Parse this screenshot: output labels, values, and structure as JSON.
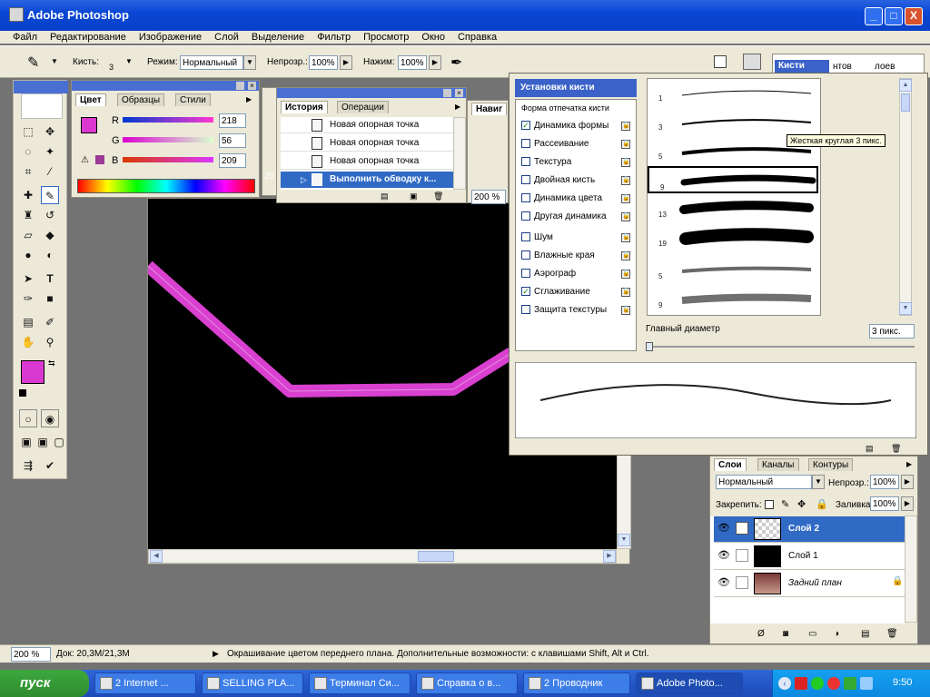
{
  "window": {
    "title": "Adobe Photoshop",
    "min_label": "_",
    "max_label": "□",
    "close_label": "X"
  },
  "menu": [
    "Файл",
    "Редактирование",
    "Изображение",
    "Слой",
    "Выделение",
    "Фильтр",
    "Просмотр",
    "Окно",
    "Справка"
  ],
  "options": {
    "brush_label": "Кисть:",
    "brush_size": "3",
    "mode_label": "Режим:",
    "mode_value": "Нормальный",
    "opacity_label": "Непрозр.:",
    "opacity_value": "100%",
    "flow_label": "Нажим:",
    "flow_value": "100%",
    "well_tabs": [
      "Кисти",
      "нтов",
      "лоев"
    ]
  },
  "color_panel": {
    "tabs": [
      "Цвет",
      "Образцы",
      "Стили"
    ],
    "r_label": "R",
    "r_value": "218",
    "g_label": "G",
    "g_value": "56",
    "b_label": "B",
    "b_value": "209",
    "foreground": "#da38d1"
  },
  "history_panel": {
    "tabs": [
      "История",
      "Операции"
    ],
    "items": [
      "Новая опорная точка",
      "Новая опорная точка",
      "Новая опорная точка",
      "Выполнить обводку к..."
    ]
  },
  "nav_panel": {
    "tab": "Навиг",
    "zoom": "200 %",
    "title_frag": "20"
  },
  "brush_settings": {
    "header": "Установки кисти",
    "tip_shape": "Форма отпечатка кисти",
    "options": [
      {
        "label": "Динамика формы",
        "checked": true
      },
      {
        "label": "Рассеивание",
        "checked": false
      },
      {
        "label": "Текстура",
        "checked": false
      },
      {
        "label": "Двойная кисть",
        "checked": false
      },
      {
        "label": "Динамика цвета",
        "checked": false
      },
      {
        "label": "Другая динамика",
        "checked": false
      },
      {
        "label": "Шум",
        "checked": false
      },
      {
        "label": "Влажные края",
        "checked": false
      },
      {
        "label": "Аэрограф",
        "checked": false
      },
      {
        "label": "Сглаживание",
        "checked": true
      },
      {
        "label": "Защита текстуры",
        "checked": false
      }
    ],
    "tooltip": "Жесткая круглая 3 пикс.",
    "diameter_label": "Главный диаметр",
    "diameter_value": "3 пикс.",
    "brushes": [
      {
        "size": "1",
        "shown": "1"
      },
      {
        "size": "3",
        "shown": "3"
      },
      {
        "size": "5",
        "shown": "5"
      },
      {
        "size": "9",
        "shown": "9"
      },
      {
        "size": "13",
        "shown": "13"
      },
      {
        "size": "19",
        "shown": "19"
      },
      {
        "size": "5",
        "shown": "5"
      },
      {
        "size": "9",
        "shown": "9"
      }
    ]
  },
  "layers_panel": {
    "tabs": [
      "Слои",
      "Каналы",
      "Контуры"
    ],
    "blend_mode": "Нормальный",
    "opacity_label": "Непрозр.:",
    "opacity_value": "100%",
    "lock_label": "Закрепить:",
    "fill_label": "Заливка:",
    "fill_value": "100%",
    "layers": [
      {
        "name": "Слой 2",
        "selected": true
      },
      {
        "name": "Слой 1",
        "selected": false
      },
      {
        "name": "Задний план",
        "selected": false
      }
    ]
  },
  "status": {
    "zoom": "200 %",
    "doc": "Док: 20,3M/21,3M",
    "message": "Окрашивание цветом переднего плана. Дополнительные возможности: с клавишами Shift, Alt и Ctrl."
  },
  "taskbar": {
    "start": "пуск",
    "tasks": [
      "2 Internet ...",
      "SELLING PLA...",
      "Терминал Си...",
      "Справка о в...",
      "2 Проводник",
      "Adobe Photo..."
    ],
    "clock": "9:50"
  },
  "colors": {
    "stroke": "#d940d0",
    "canvas": "#000000",
    "titlebar": "#0a47d4"
  }
}
